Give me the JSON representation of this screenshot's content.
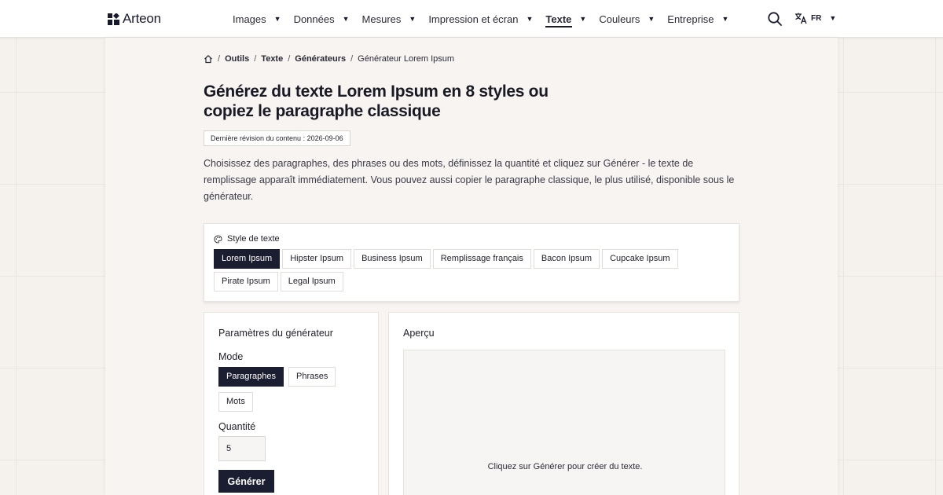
{
  "header": {
    "logo_text": "Arteon",
    "nav": [
      {
        "label": "Images"
      },
      {
        "label": "Données"
      },
      {
        "label": "Mesures"
      },
      {
        "label": "Impression et écran"
      },
      {
        "label": "Texte",
        "active": true
      },
      {
        "label": "Couleurs"
      },
      {
        "label": "Entreprise"
      }
    ],
    "lang_code": "FR",
    "search_icon": "search-icon",
    "translate_icon": "translate-icon"
  },
  "breadcrumb": {
    "items": [
      "Outils",
      "Texte",
      "Générateurs"
    ],
    "current": "Générateur Lorem Ipsum"
  },
  "page": {
    "title": "Générez du texte Lorem Ipsum en 8 styles ou copiez le paragraphe classique",
    "revision": "Dernière révision du contenu : 2026-09-06",
    "intro": "Choisissez des paragraphes, des phrases ou des mots, définissez la quantité et cliquez sur Générer - le texte de remplissage apparaît immédiatement. Vous pouvez aussi copier le paragraphe classique, le plus utilisé, disponible sous le générateur."
  },
  "styles": {
    "label": "Style de texte",
    "options": [
      "Lorem Ipsum",
      "Hipster Ipsum",
      "Business Ipsum",
      "Remplissage français",
      "Bacon Ipsum",
      "Cupcake Ipsum",
      "Pirate Ipsum",
      "Legal Ipsum"
    ],
    "selected": "Lorem Ipsum"
  },
  "params": {
    "title": "Paramètres du générateur",
    "mode_label": "Mode",
    "modes": [
      "Paragraphes",
      "Phrases",
      "Mots"
    ],
    "selected_mode": "Paragraphes",
    "quantity_label": "Quantité",
    "quantity_value": "5",
    "generate_label": "Générer"
  },
  "preview": {
    "title": "Aperçu",
    "empty_text": "Cliquez sur Générer pour créer du texte."
  },
  "colors": {
    "accent": "#1b1d30",
    "background": "#f5f1ed"
  }
}
